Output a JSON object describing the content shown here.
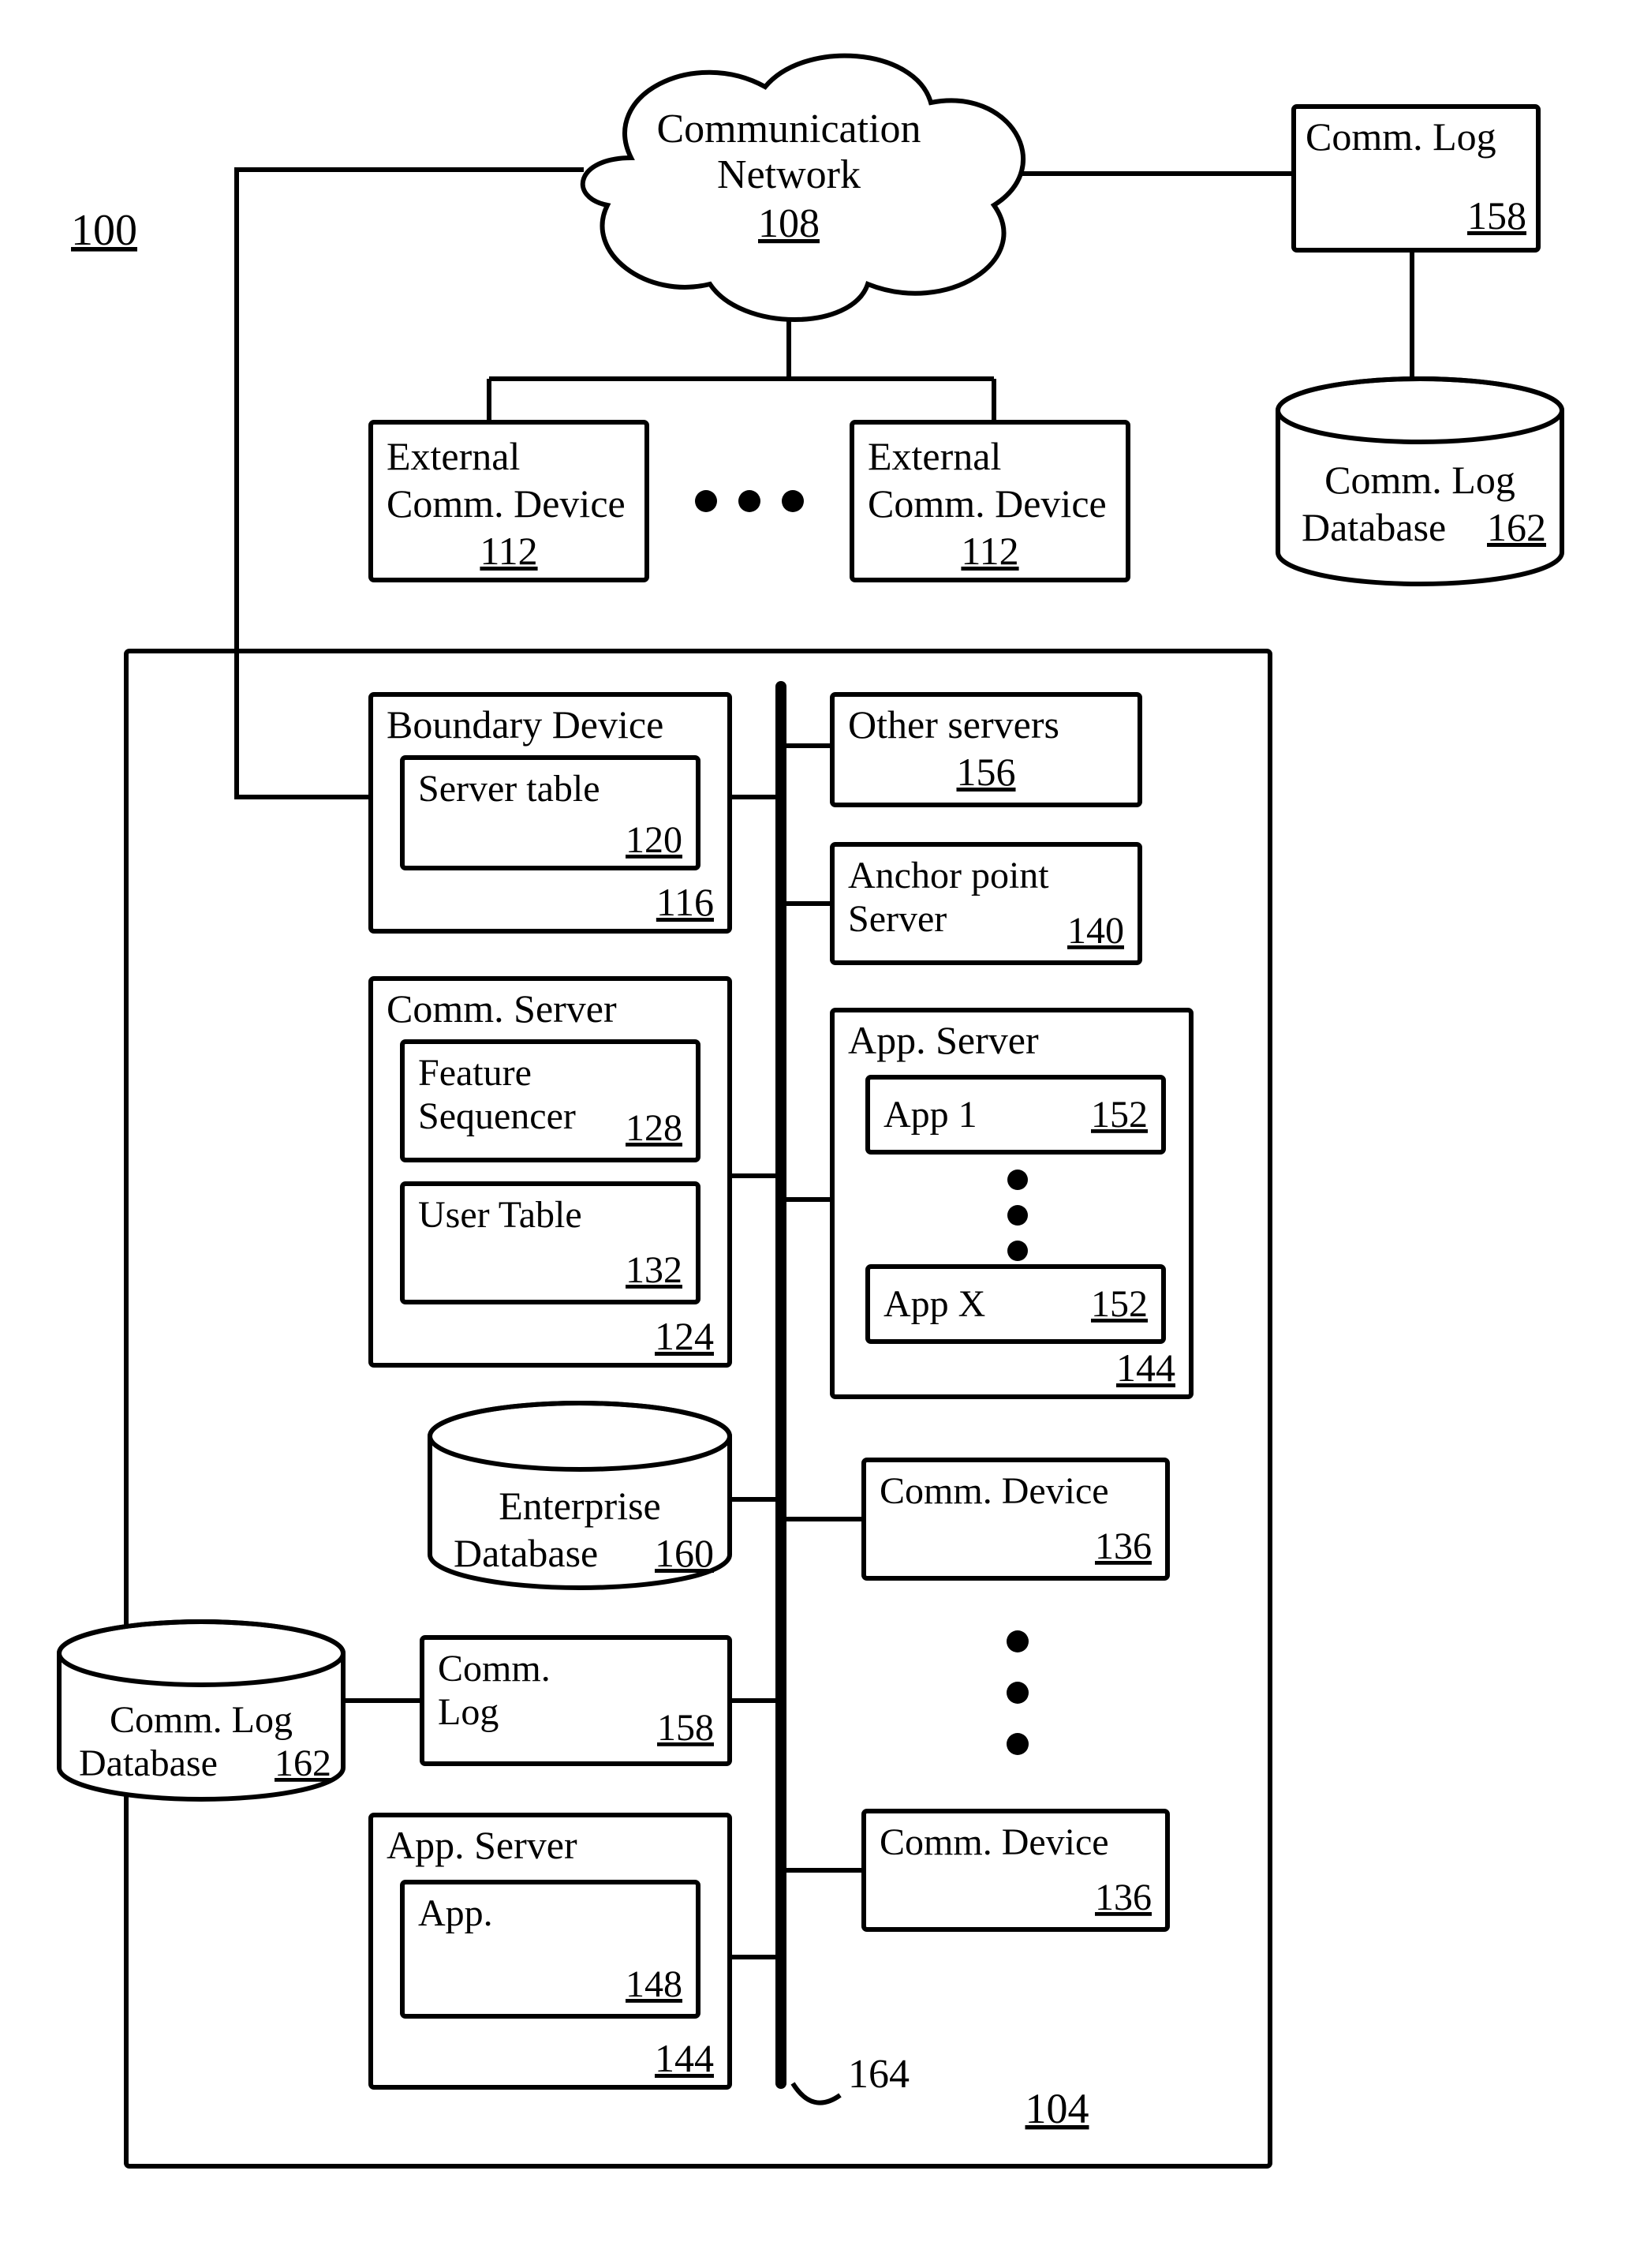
{
  "figure": {
    "ref": "100"
  },
  "enterprise": {
    "ref": "104"
  },
  "bus": {
    "ref": "164"
  },
  "cloud": {
    "label_line1": "Communication",
    "label_line2": "Network",
    "ref": "108"
  },
  "ext_device": {
    "label_line1": "External",
    "label_line2": "Comm. Device",
    "ref": "112"
  },
  "comm_log": {
    "label": "Comm. Log",
    "ref": "158"
  },
  "comm_log_db": {
    "label_line1": "Comm. Log",
    "label_line2": "Database",
    "ref": "162"
  },
  "boundary_device": {
    "label": "Boundary Device",
    "ref": "116",
    "server_table": {
      "label": "Server table",
      "ref": "120"
    }
  },
  "comm_server": {
    "label": "Comm. Server",
    "ref": "124",
    "feature_seq": {
      "label_line1": "Feature",
      "label_line2": "Sequencer",
      "ref": "128"
    },
    "user_table": {
      "label": "User Table",
      "ref": "132"
    }
  },
  "other_servers": {
    "label": "Other servers",
    "ref": "156"
  },
  "anchor_server": {
    "label_line1": "Anchor point",
    "label_line2": "Server",
    "ref": "140"
  },
  "app_server_right": {
    "label": "App. Server",
    "ref": "144",
    "app1": {
      "label": "App 1",
      "ref": "152"
    },
    "appX": {
      "label": "App X",
      "ref": "152"
    }
  },
  "enterprise_db": {
    "label_line1": "Enterprise",
    "label_line2": "Database",
    "ref": "160"
  },
  "comm_log_inner": {
    "label_line1": "Comm.",
    "label_line2": "Log",
    "ref": "158"
  },
  "comm_log_db_left": {
    "label_line1": "Comm. Log",
    "label_line2": "Database",
    "ref": "162"
  },
  "app_server_left": {
    "label": "App. Server",
    "ref": "144",
    "app": {
      "label": "App.",
      "ref": "148"
    }
  },
  "comm_device": {
    "label": "Comm. Device",
    "ref": "136"
  }
}
